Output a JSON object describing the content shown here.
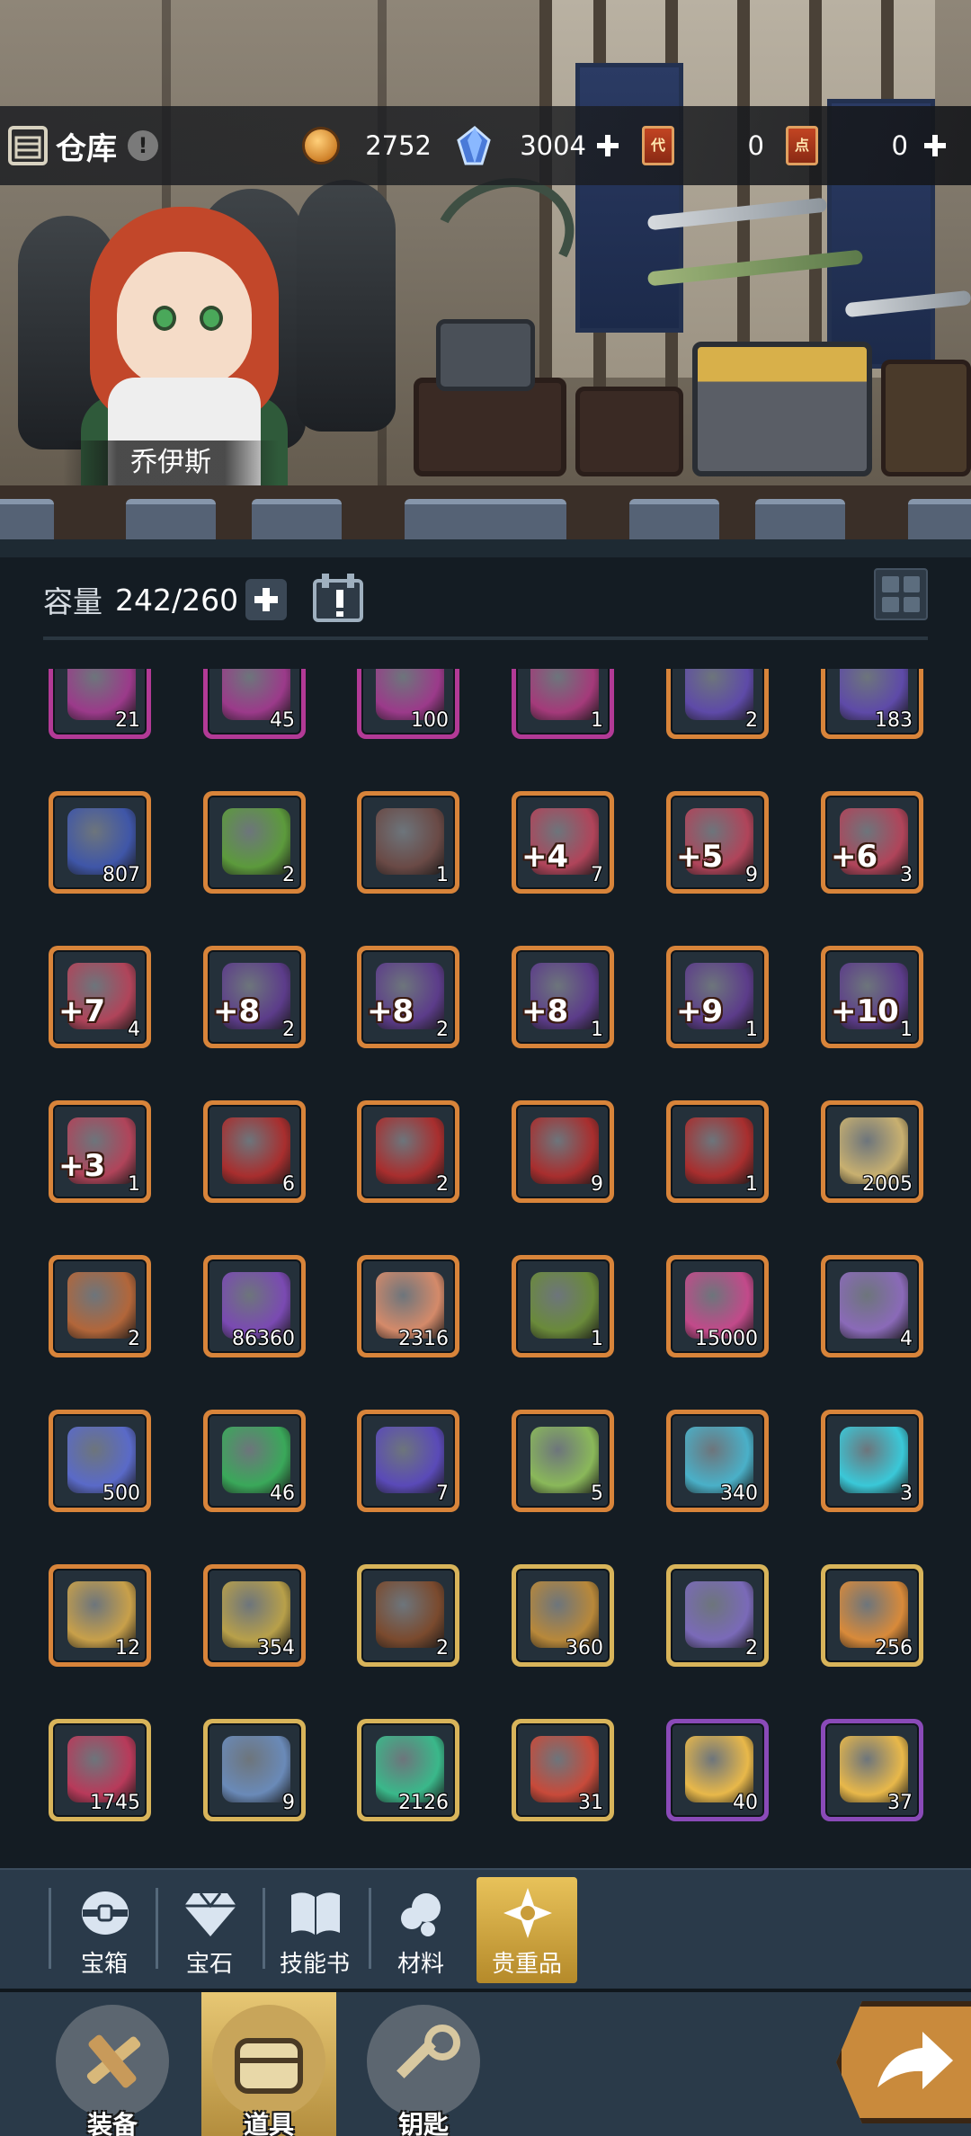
{
  "header": {
    "title": "仓库",
    "help": "!",
    "currencies": [
      {
        "icon": "gold-coin-icon",
        "value": "2752"
      },
      {
        "icon": "blue-crystal-icon",
        "value": "3004"
      },
      {
        "icon": "red-ticket-icon",
        "glyph": "代",
        "value": "0"
      },
      {
        "icon": "red-ticket-icon",
        "glyph": "点",
        "value": "0"
      }
    ]
  },
  "character": {
    "name": "乔伊斯"
  },
  "storage": {
    "label": "容量",
    "value": "242/260"
  },
  "colors": {
    "frame_orange": "#d8843a",
    "frame_magenta": "#b23a96",
    "frame_gold": "#d8b45a",
    "frame_purple": "#8a4ab8",
    "active_tab": "#e0b54e",
    "background": "#141c23"
  },
  "items": [
    {
      "icon": "weapon-enhance-scroll-icon",
      "frame": "magenta",
      "qty": "21",
      "color": "#9b3a8a"
    },
    {
      "icon": "ring-enhance-scroll-icon",
      "frame": "magenta",
      "qty": "45",
      "color": "#9b3a8a"
    },
    {
      "icon": "armor-enhance-scroll-icon",
      "frame": "magenta",
      "qty": "100",
      "color": "#9b3a8a"
    },
    {
      "icon": "gear-scroll-icon",
      "frame": "magenta",
      "qty": "1",
      "color": "#a43a7a"
    },
    {
      "icon": "magic-purple-scroll-icon",
      "frame": "orange",
      "qty": "2",
      "color": "#5e4aa8"
    },
    {
      "icon": "magic-purple-scroll-icon",
      "frame": "orange",
      "qty": "183",
      "color": "#5e4aa8"
    },
    {
      "icon": "blue-magic-tome-icon",
      "frame": "orange",
      "qty": "807",
      "color": "#3f56a8"
    },
    {
      "icon": "green-scroll-icon",
      "frame": "orange",
      "qty": "2",
      "color": "#5c9a3c"
    },
    {
      "icon": "mushroom-icon",
      "frame": "orange",
      "qty": "1",
      "color": "#6a4a46"
    },
    {
      "icon": "enhance-scroll-icon",
      "frame": "orange",
      "enh": "+4",
      "qty": "7",
      "color": "#b0445a"
    },
    {
      "icon": "enhance-scroll-icon",
      "frame": "orange",
      "enh": "+5",
      "qty": "9",
      "color": "#b0445a"
    },
    {
      "icon": "enhance-scroll-icon",
      "frame": "orange",
      "enh": "+6",
      "qty": "3",
      "color": "#b0445a"
    },
    {
      "icon": "enhance-scroll-icon",
      "frame": "orange",
      "enh": "+7",
      "qty": "4",
      "color": "#b0445a"
    },
    {
      "icon": "mystery-enhance-scroll-icon",
      "frame": "orange",
      "enh": "+8",
      "qty": "2",
      "color": "#5c3c8a"
    },
    {
      "icon": "mystery-enhance-scroll-icon",
      "frame": "orange",
      "enh": "+8",
      "qty": "2",
      "color": "#5c3c8a"
    },
    {
      "icon": "mystery-enhance-scroll-icon",
      "frame": "orange",
      "enh": "+8",
      "qty": "1",
      "color": "#5c3c8a"
    },
    {
      "icon": "mystery-enhance-scroll-icon",
      "frame": "orange",
      "enh": "+9",
      "qty": "1",
      "color": "#5c3c8a"
    },
    {
      "icon": "mystery-enhance-scroll-icon",
      "frame": "orange",
      "enh": "+10",
      "qty": "1",
      "color": "#5c3c8a"
    },
    {
      "icon": "enhance-scroll-icon",
      "frame": "orange",
      "enh": "+3",
      "qty": "1",
      "color": "#b0445a"
    },
    {
      "icon": "red-scroll-icon",
      "frame": "orange",
      "qty": "6",
      "color": "#a82e2e"
    },
    {
      "icon": "red-scroll-icon",
      "frame": "orange",
      "qty": "2",
      "color": "#a82e2e"
    },
    {
      "icon": "red-scroll-icon",
      "frame": "orange",
      "qty": "9",
      "color": "#a82e2e"
    },
    {
      "icon": "red-scroll-icon",
      "frame": "orange",
      "qty": "1",
      "color": "#a82e2e"
    },
    {
      "icon": "angel-wing-coin-icon",
      "frame": "orange",
      "qty": "2005",
      "color": "#c8b070"
    },
    {
      "icon": "copper-ore-icon",
      "frame": "orange",
      "qty": "2",
      "color": "#b2663a"
    },
    {
      "icon": "purple-crystal-icon",
      "frame": "orange",
      "qty": "86360",
      "color": "#7a4ab2"
    },
    {
      "icon": "cookie-icon",
      "frame": "orange",
      "qty": "2316",
      "color": "#d48a6a"
    },
    {
      "icon": "seed-pouch-icon",
      "frame": "orange",
      "qty": "1",
      "color": "#6a8a3a"
    },
    {
      "icon": "pink-crystal-icon",
      "frame": "orange",
      "qty": "15000",
      "color": "#c24a8a"
    },
    {
      "icon": "candy-roll-icon",
      "frame": "orange",
      "qty": "4",
      "color": "#8a6ab8"
    },
    {
      "icon": "paw-badge-icon",
      "frame": "orange",
      "qty": "500",
      "color": "#5a6ac8"
    },
    {
      "icon": "green-potion-icon",
      "frame": "orange",
      "qty": "46",
      "color": "#3aa85a"
    },
    {
      "icon": "purple-amulet-icon",
      "frame": "orange",
      "qty": "7",
      "color": "#5a4ab8"
    },
    {
      "icon": "skill-scroll-icon",
      "frame": "orange",
      "qty": "5",
      "color": "#8ab85a"
    },
    {
      "icon": "time-orb-icon",
      "frame": "orange",
      "qty": "340",
      "color": "#4ab0c8"
    },
    {
      "icon": "crystal-orb-icon",
      "frame": "orange",
      "qty": "3",
      "color": "#3ac8d8"
    },
    {
      "icon": "blue-gear-icon",
      "frame": "orange",
      "qty": "12",
      "color": "#c8a04a"
    },
    {
      "icon": "teal-gear-icon",
      "frame": "orange",
      "qty": "354",
      "color": "#b8a04a"
    },
    {
      "icon": "chocolate-icon",
      "frame": "gold",
      "qty": "2",
      "color": "#7a4a2e"
    },
    {
      "icon": "guild-shield-icon",
      "frame": "gold",
      "qty": "360",
      "color": "#b8883a"
    },
    {
      "icon": "star-shard-icon",
      "frame": "gold",
      "qty": "2",
      "color": "#7a6ab8"
    },
    {
      "icon": "orange-star-icon",
      "frame": "gold",
      "qty": "256",
      "color": "#d88a3a"
    },
    {
      "icon": "gem-shield-icon",
      "frame": "gold",
      "qty": "1745",
      "color": "#b83a5a"
    },
    {
      "icon": "ice-cube-icon",
      "frame": "gold",
      "qty": "9",
      "color": "#6a8ab8"
    },
    {
      "icon": "green-elixir-icon",
      "frame": "gold",
      "qty": "2126",
      "color": "#3ab88a"
    },
    {
      "icon": "fire-spirit-icon",
      "frame": "gold",
      "qty": "31",
      "color": "#c84a3a"
    },
    {
      "icon": "cheese-icon",
      "frame": "purple",
      "qty": "40",
      "color": "#e8b84a"
    },
    {
      "icon": "cheese-icon",
      "frame": "purple",
      "qty": "37",
      "color": "#e8b84a"
    }
  ],
  "categories": [
    {
      "id": "chest",
      "label": "宝箱",
      "icon": "chest-icon"
    },
    {
      "id": "gem",
      "label": "宝石",
      "icon": "gem-icon"
    },
    {
      "id": "skillbook",
      "label": "技能书",
      "icon": "book-icon"
    },
    {
      "id": "material",
      "label": "材料",
      "icon": "material-icon"
    },
    {
      "id": "valuables",
      "label": "贵重品",
      "icon": "valuables-icon",
      "active": true
    }
  ],
  "nav": [
    {
      "id": "equipment",
      "label": "装备",
      "icon": "equipment-icon"
    },
    {
      "id": "items",
      "label": "道具",
      "icon": "items-chest-icon",
      "active": true
    },
    {
      "id": "keys",
      "label": "钥匙",
      "icon": "key-icon"
    }
  ]
}
